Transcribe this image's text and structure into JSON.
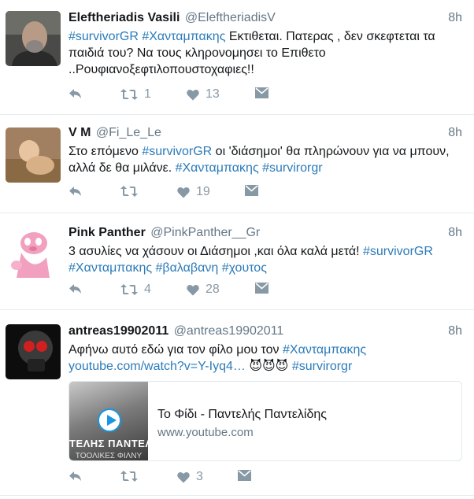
{
  "tweets": [
    {
      "name": "Eleftheriadis Vasili",
      "handle": "@EleftheriadisV",
      "time": "8h",
      "text_segments": [
        {
          "t": "#survivorGR",
          "link": true
        },
        {
          "t": " ",
          "link": false
        },
        {
          "t": "#Χανταμπακης",
          "link": true
        },
        {
          "t": " Εκτιθεται. Πατερας , δεν σκεφτεται τα παιδιά του? Να τους κληρονομησει το Επιθετο ..Ρουφιανοξεφτιλοπουστοχαφιες!!",
          "link": false
        }
      ],
      "replies": "",
      "retweets": "1",
      "likes": "13"
    },
    {
      "name": "V M",
      "handle": "@Fi_Le_Le",
      "time": "8h",
      "text_segments": [
        {
          "t": "Στο επόμενο ",
          "link": false
        },
        {
          "t": "#survivorGR",
          "link": true
        },
        {
          "t": " οι 'διάσημοι' θα πληρώνουν για να μπουν, αλλά δε θα μιλάνε. ",
          "link": false
        },
        {
          "t": "#Χανταμπακης",
          "link": true
        },
        {
          "t": " ",
          "link": false
        },
        {
          "t": "#survirorgr",
          "link": true
        }
      ],
      "replies": "",
      "retweets": "",
      "likes": "19"
    },
    {
      "name": "Pink Panther",
      "handle": "@PinkPanther__Gr",
      "time": "8h",
      "text_segments": [
        {
          "t": "3 ασυλίες να χάσουν οι Διάσημοι ,και όλα καλά μετά! ",
          "link": false
        },
        {
          "t": "#survivorGR",
          "link": true
        },
        {
          "t": " ",
          "link": false
        },
        {
          "t": "#Χανταμπακης",
          "link": true
        },
        {
          "t": "  ",
          "link": false
        },
        {
          "t": "#βαλαβανη",
          "link": true
        },
        {
          "t": "  ",
          "link": false
        },
        {
          "t": "#χουτος",
          "link": true
        }
      ],
      "replies": "",
      "retweets": "4",
      "likes": "28"
    },
    {
      "name": "antreas19902011",
      "handle": "@antreas19902011",
      "time": "8h",
      "text_segments": [
        {
          "t": "Αφήνω αυτό εδώ για τον φίλο μου τον ",
          "link": false
        },
        {
          "t": "#Χανταμπακης",
          "link": true
        },
        {
          "t": " ",
          "link": false
        },
        {
          "t": "youtube.com/watch?v=Y-Iyq4…",
          "link": true
        },
        {
          "t": " 😈😈😈 ",
          "link": false
        },
        {
          "t": "#survirorgr",
          "link": true
        }
      ],
      "card": {
        "title": "Το Φίδι - Παντελής Παντελίδης",
        "domain": "www.youtube.com",
        "thumb_caption": "ΤΕΛΗΣ ΠΑΝΤΕΛ",
        "thumb_caption2": "ΤΟΟΛΙΚΕΣ ΦΙΛΝΥ"
      },
      "replies": "",
      "retweets": "",
      "likes": "3"
    }
  ],
  "colors": {
    "link": "#2b7bb9",
    "muted": "#657786",
    "icon": "#8899a6",
    "divider": "#e6ecf0"
  }
}
